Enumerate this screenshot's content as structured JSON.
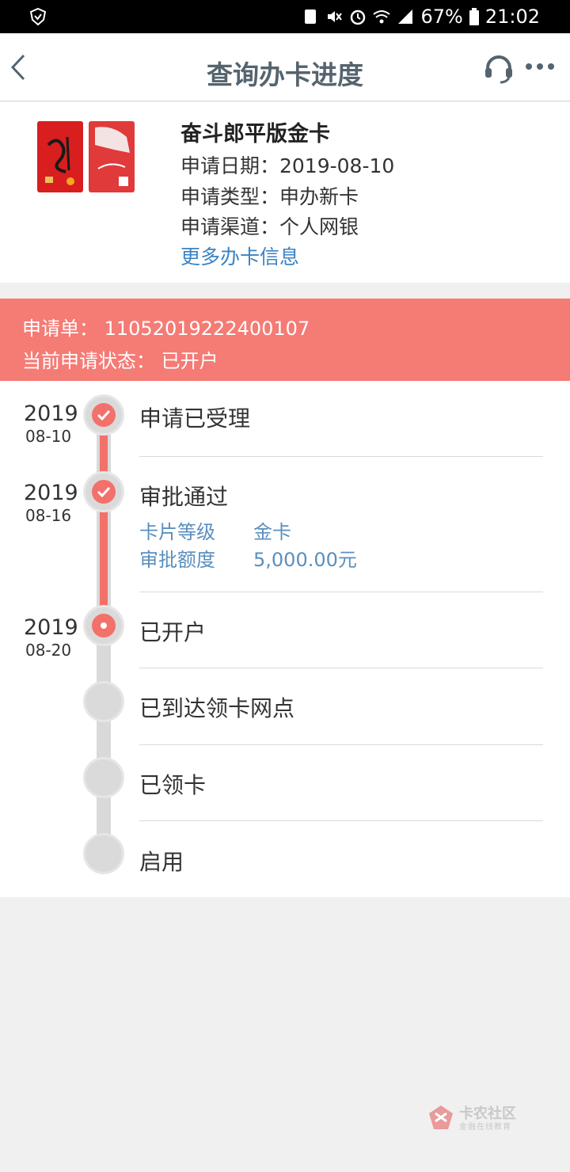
{
  "status_bar": {
    "battery": "67%",
    "time": "21:02",
    "network": "4G"
  },
  "header": {
    "title": "查询办卡进度"
  },
  "card": {
    "name": "奋斗郎平版金卡",
    "apply_date_line": "申请日期：2019-08-10",
    "apply_type_line": "申请类型：申办新卡",
    "apply_channel_line": "申请渠道：个人网银",
    "more_info_link": "更多办卡信息"
  },
  "banner": {
    "application_line": "申请单： 11052019222400107",
    "status_line": "当前申请状态： 已开户"
  },
  "timeline": {
    "steps": [
      {
        "year": "2019",
        "date": "08-10",
        "label": "申请已受理"
      },
      {
        "year": "2019",
        "date": "08-16",
        "label": "审批通过"
      },
      {
        "year": "2019",
        "date": "08-20",
        "label": "已开户"
      },
      {
        "label": "已到达领卡网点"
      },
      {
        "label": "已领卡"
      },
      {
        "label": "启用"
      }
    ],
    "details": {
      "card_level_label": "卡片等级",
      "card_level_value": "金卡",
      "credit_label": "审批额度",
      "credit_value": "5,000.00元"
    }
  },
  "watermark": {
    "name": "卡农社区",
    "tagline": "金融在线教育"
  },
  "colors": {
    "accent_red": "#f57b75",
    "title_gray": "#55646e",
    "link_blue": "#3b82c4"
  }
}
